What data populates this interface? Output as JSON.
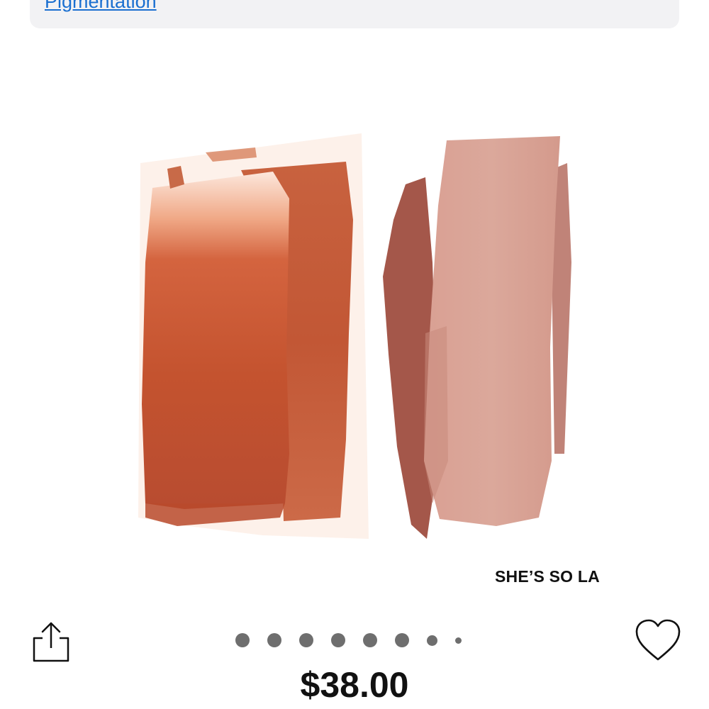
{
  "top_link": {
    "label": "Pigmentation"
  },
  "product_image": {
    "shade_label": "SHE’S SO LA"
  },
  "gallery": {
    "dot_count": 8,
    "active_index": 0
  },
  "actions": {
    "share_icon": "share-icon",
    "favorite_icon": "heart-icon"
  },
  "price": "$38.00",
  "colors": {
    "link": "#1a6fd0",
    "blush_swatch": "#c8593a",
    "powder_swatch": "#d79f92"
  }
}
